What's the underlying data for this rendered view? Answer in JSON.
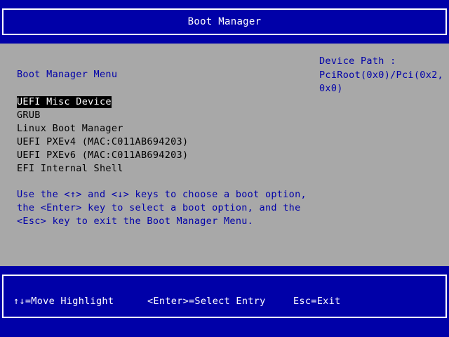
{
  "header": {
    "title": "Boot Manager"
  },
  "main": {
    "menu_title": "Boot Manager Menu",
    "device_path_label": "Device Path :",
    "device_path_value": "PciRoot(0x0)/Pci(0x2,0x0)",
    "boot_options": [
      "UEFI Misc Device",
      "GRUB",
      "Linux Boot Manager",
      "UEFI PXEv4 (MAC:C011AB694203)",
      "UEFI PXEv6 (MAC:C011AB694203)",
      "EFI Internal Shell"
    ],
    "selected_index": 0,
    "help_lines": [
      "Use the <↑> and <↓> keys to choose a boot option,",
      "the <Enter> key to select a boot option, and the",
      "<Esc> key to exit the Boot Manager Menu."
    ]
  },
  "footer": {
    "move_hint": "↑↓=Move Highlight",
    "enter_hint": "<Enter>=Select Entry",
    "esc_hint": "Esc=Exit"
  },
  "colors": {
    "background_blue": "#0000a8",
    "panel_gray": "#a8a8a8",
    "text_white": "#ffffff",
    "text_black": "#000000",
    "highlight_bg": "#000000"
  }
}
